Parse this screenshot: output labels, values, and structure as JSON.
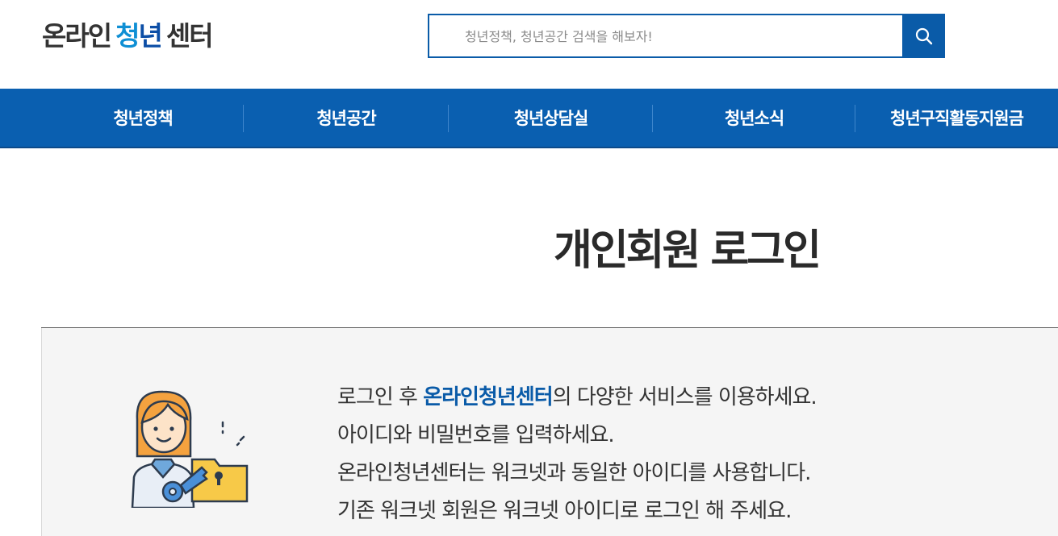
{
  "header": {
    "logo": {
      "part1": "온라인",
      "part2a": "청",
      "part2b": "년",
      "part3": "센터"
    },
    "search": {
      "placeholder": "청년정책, 청년공간 검색을 해보자!",
      "value": ""
    }
  },
  "nav": {
    "items": [
      {
        "label": "청년정책"
      },
      {
        "label": "청년공간"
      },
      {
        "label": "청년상담실"
      },
      {
        "label": "청년소식"
      },
      {
        "label": "청년구직활동지원금"
      }
    ]
  },
  "main": {
    "title": "개인회원 로그인",
    "info": {
      "line1_a": "로그인 후 ",
      "line1_highlight": "온라인청년센터",
      "line1_b": "의 다양한 서비스를 이용하세요.",
      "line2": "아이디와 비밀번호를 입력하세요.",
      "line3": "온라인청년센터는 워크넷과 동일한 아이디를 사용합니다.",
      "line4": "기존 워크넷 회원은 워크넷 아이디로 로그인 해 주세요."
    }
  },
  "colors": {
    "brand_blue": "#0a5ba8",
    "nav_blue": "#0a5fb0",
    "logo_light_blue": "#0f8fd4",
    "panel_bg": "#f5f5f5"
  },
  "icons": [
    "search-icon",
    "login-person-illustration"
  ]
}
